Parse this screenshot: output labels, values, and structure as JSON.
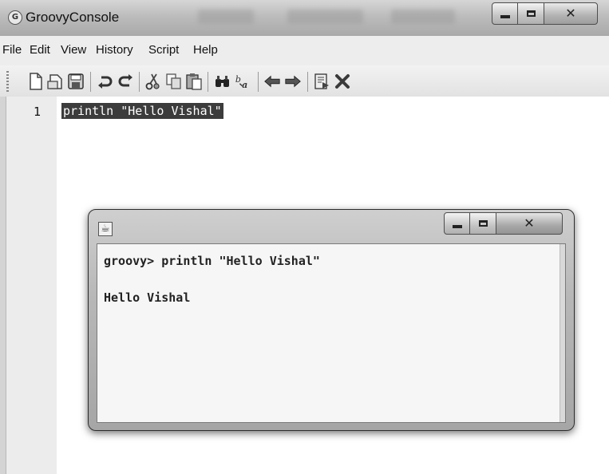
{
  "window": {
    "title": "GroovyConsole",
    "app_icon": "G",
    "controls": {
      "minimize": "minimize-icon",
      "maximize": "maximize-icon",
      "close": "✕"
    }
  },
  "menu": {
    "items": [
      "File",
      "Edit",
      "View",
      "History",
      "Script",
      "Help"
    ]
  },
  "toolbar": {
    "icons": [
      "new-file-icon",
      "open-icon",
      "save-icon",
      "undo-icon",
      "redo-icon",
      "cut-icon",
      "copy-icon",
      "paste-icon",
      "find-icon",
      "replace-icon",
      "previous-history-icon",
      "next-history-icon",
      "run-script-icon",
      "clear-output-icon"
    ]
  },
  "editor": {
    "line_number": "1",
    "code": "println \"Hello Vishal\""
  },
  "output_dialog": {
    "icon": "java-icon",
    "command_line": "groovy> println \"Hello Vishal\"",
    "result_line": "Hello Vishal",
    "close_glyph": "✕"
  }
}
